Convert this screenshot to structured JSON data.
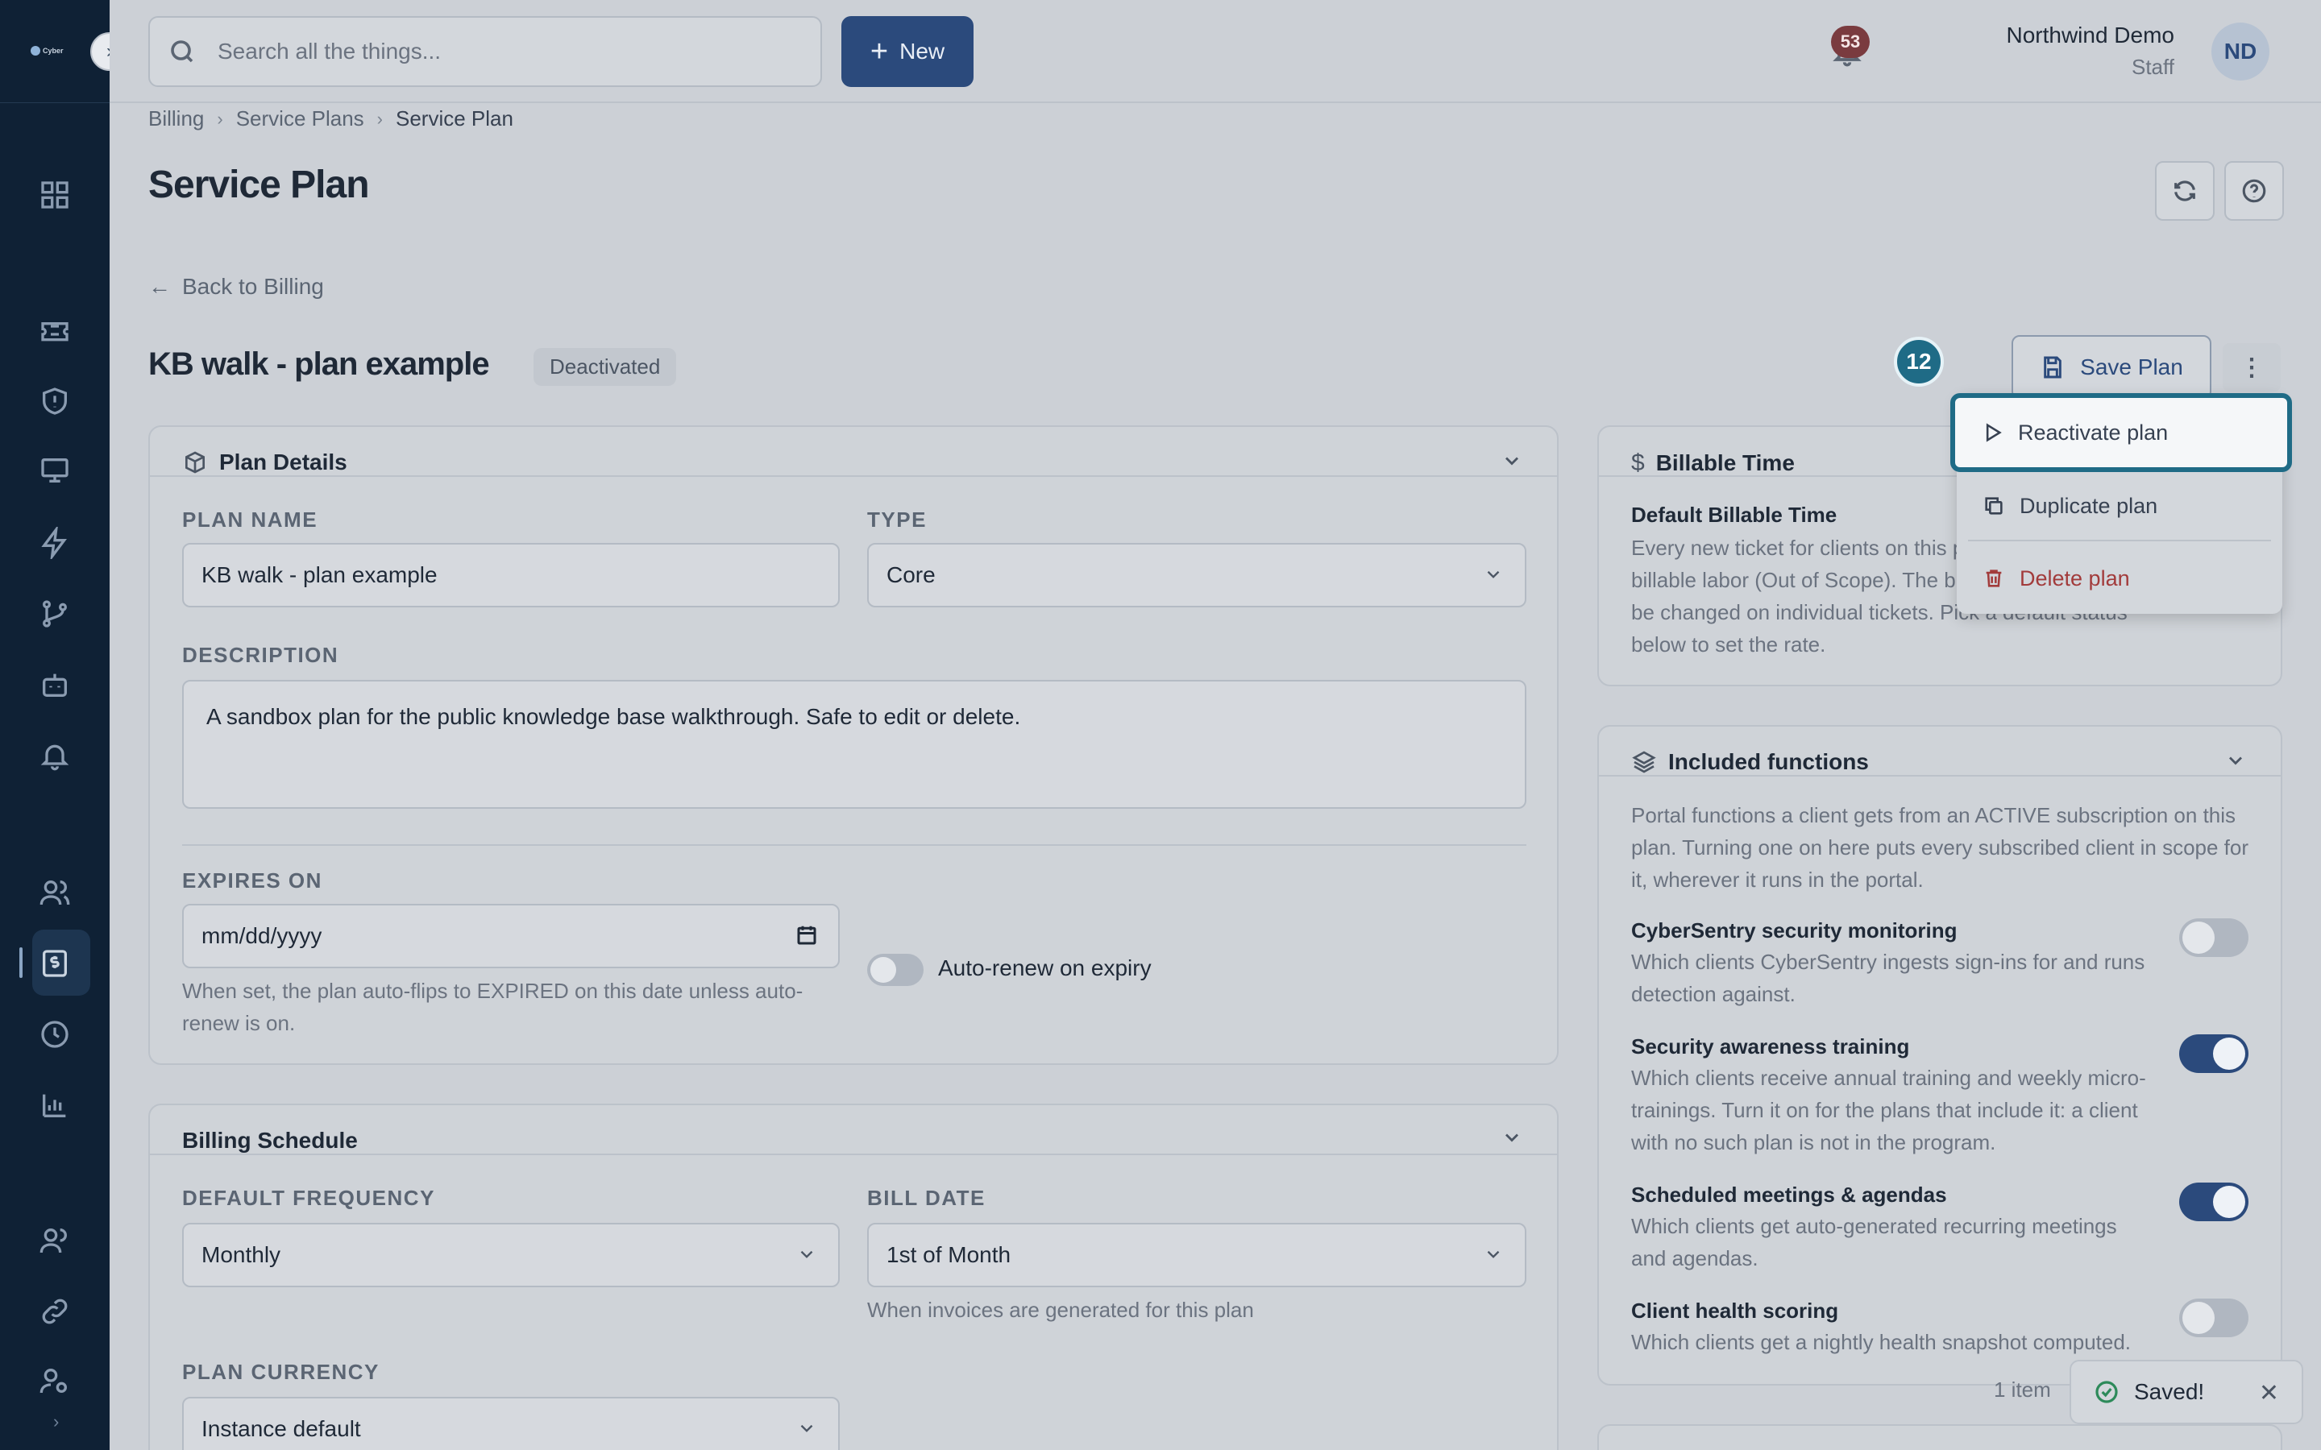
{
  "app": {
    "logo_text": "Cyber"
  },
  "search": {
    "placeholder": "Search all the things..."
  },
  "toolbar": {
    "new_label": "New"
  },
  "notifications": {
    "count": "53"
  },
  "user": {
    "name": "Northwind Demo",
    "role": "Staff",
    "initials": "ND"
  },
  "breadcrumb": [
    "Billing",
    "Service Plans",
    "Service Plan"
  ],
  "page": {
    "title": "Service Plan",
    "back_label": "Back to Billing"
  },
  "plan": {
    "name": "KB walk - plan example",
    "status": "Deactivated",
    "save_label": "Save Plan",
    "step_number": "12"
  },
  "menu": {
    "items": [
      "Reactivate plan",
      "Duplicate plan",
      "Delete plan"
    ]
  },
  "plan_details": {
    "title": "Plan Details",
    "name_label": "PLAN NAME",
    "name_value": "KB walk - plan example",
    "type_label": "TYPE",
    "type_value": "Core",
    "description_label": "DESCRIPTION",
    "description_value": "A sandbox plan for the public knowledge base walkthrough. Safe to edit or delete.",
    "expires_label": "EXPIRES ON",
    "expires_placeholder": "mm/dd/yyyy",
    "expires_help_1": "When set, the plan auto-flips to EXPIRED on this date unless auto-",
    "expires_help_2": "renew is on.",
    "auto_renew_label": "Auto-renew on expiry",
    "auto_renew_on": false
  },
  "billing_schedule": {
    "title": "Billing Schedule",
    "frequency_label": "DEFAULT FREQUENCY",
    "frequency_value": "Monthly",
    "bill_date_label": "BILL DATE",
    "bill_date_value": "1st of Month",
    "bill_date_help": "When invoices are generated for this plan",
    "currency_label": "PLAN CURRENCY",
    "currency_value": "Instance default"
  },
  "billable_time": {
    "title": "Billable Time",
    "subtitle": "Default Billable Time",
    "lines": [
      "Every new ticket for clients on this p",
      "billable labor (Out of Scope). The bi",
      "be changed on individual tickets. Pick a default status",
      "below to set the rate."
    ]
  },
  "included_functions": {
    "title": "Included functions",
    "intro": [
      "Portal functions a client gets from an ACTIVE subscription on this",
      "plan. Turning one on here puts every subscribed client in scope for",
      "it, wherever it runs in the portal."
    ],
    "items": [
      {
        "title": "CyberSentry security monitoring",
        "desc": [
          "Which clients CyberSentry ingests sign-ins for and runs",
          "detection against."
        ],
        "on": false
      },
      {
        "title": "Security awareness training",
        "desc": [
          "Which clients receive annual training and weekly micro-",
          "trainings. Turn it on for the plans that include it: a client",
          "with no such plan is not in the program."
        ],
        "on": true
      },
      {
        "title": "Scheduled meetings & agendas",
        "desc": [
          "Which clients get auto-generated recurring meetings",
          "and agendas."
        ],
        "on": true
      },
      {
        "title": "Client health scoring",
        "desc": [
          "Which clients get a nightly health snapshot computed."
        ],
        "on": false
      }
    ],
    "items_count": "1 item"
  },
  "toast": {
    "message": "Saved!"
  },
  "colors": {
    "accent": "#2b4a7c",
    "sidebar": "#0f2135",
    "highlight": "#1f6b86",
    "danger": "#a23b3b",
    "success": "#2d8a5a"
  }
}
